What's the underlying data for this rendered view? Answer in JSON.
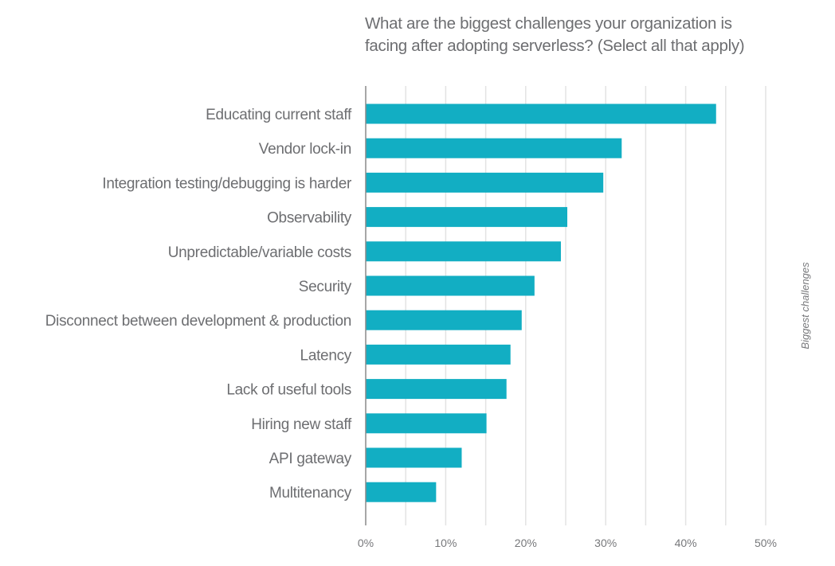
{
  "chart_data": {
    "type": "bar",
    "orientation": "horizontal",
    "title": "What are the biggest challenges your organization is facing after adopting serverless? (Select all that apply)",
    "title_lines": [
      "What are the biggest challenges your organization is",
      "facing after adopting serverless? (Select all that apply)"
    ],
    "categories": [
      "Educating current staff",
      "Vendor lock-in",
      "Integration testing/debugging is harder",
      "Observability",
      "Unpredictable/variable costs",
      "Security",
      "Disconnect between development & production",
      "Latency",
      "Lack of useful tools",
      "Hiring new staff",
      "API gateway",
      "Multitenancy"
    ],
    "values": [
      43.8,
      32.0,
      29.7,
      25.2,
      24.4,
      21.1,
      19.5,
      18.1,
      17.6,
      15.1,
      12.0,
      8.8
    ],
    "series": [
      {
        "name": "Biggest challenges",
        "color": "#12aec3"
      }
    ],
    "xlabel": "",
    "ylabel": "",
    "xlim": [
      0,
      50
    ],
    "xticks": [
      0,
      10,
      20,
      30,
      40,
      50
    ],
    "xtick_labels": [
      "0%",
      "10%",
      "20%",
      "30%",
      "40%",
      "50%"
    ],
    "minor_gridlines_every": 5,
    "grid": true,
    "legend": {
      "entries": [
        "Biggest challenges"
      ],
      "placement": "right",
      "orientation": "vertical"
    },
    "colors": {
      "bar": "#12aec3",
      "grid": "#e3e3e3",
      "axis": "#8a8a8a",
      "text": "#6d6e71"
    }
  }
}
